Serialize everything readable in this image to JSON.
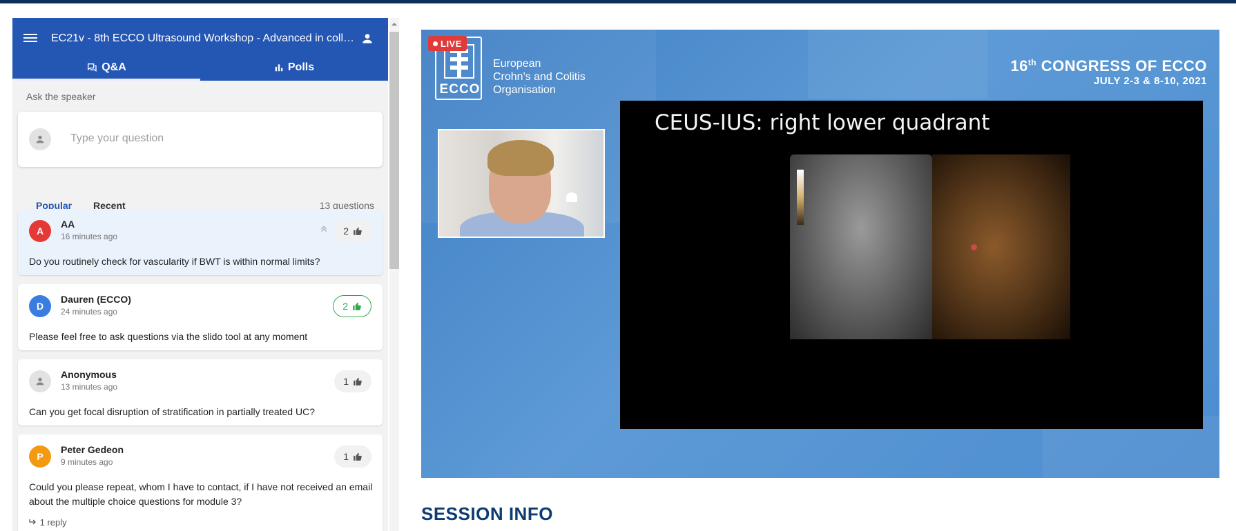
{
  "header": {
    "title": "EC21v - 8th ECCO Ultrasound Workshop - Advanced in colla..."
  },
  "tabs": [
    {
      "label": "Q&A"
    },
    {
      "label": "Polls"
    }
  ],
  "ask": {
    "label": "Ask the speaker",
    "placeholder": "Type your question"
  },
  "sort": {
    "popular": "Popular",
    "recent": "Recent",
    "count": "13 questions"
  },
  "questions": [
    {
      "initial": "A",
      "author": "AA",
      "time": "16 minutes ago",
      "likes": "2",
      "text": "Do you routinely check for vascularity if BWT is within normal limits?",
      "avatar_color": "#e53935"
    },
    {
      "initial": "D",
      "author": "Dauren (ECCO)",
      "time": "24 minutes ago",
      "likes": "2",
      "text": "Please feel free to ask questions via the slido tool at any moment",
      "avatar_color": "#3a7de0"
    },
    {
      "initial": "",
      "author": "Anonymous",
      "time": "13 minutes ago",
      "likes": "1",
      "text": "Can you get focal disruption of stratification in partially treated UC?",
      "avatar_color": "#e2e2e2"
    },
    {
      "initial": "P",
      "author": "Peter Gedeon",
      "time": "9 minutes ago",
      "likes": "1",
      "text": "Could you please repeat, whom I have to contact, if I have not received an email about the multiple choice questions for module 3?",
      "avatar_color": "#f39a12",
      "reply": "1 reply"
    }
  ],
  "video": {
    "live_badge": "LIVE",
    "logo_text": "ECCO",
    "org_line1": "European",
    "org_line2": "Crohn's and Colitis",
    "org_line3": "Organisation",
    "congress_num": "16",
    "congress_sup": "th",
    "congress_rest": " CONGRESS OF ECCO",
    "congress_dates": "JULY 2-3 & 8-10, 2021",
    "slide_title": "CEUS-IUS: right lower quadrant"
  },
  "session_info": "SESSION INFO",
  "colors": {
    "accent": "#2456b3",
    "liked": "#2ea84a",
    "session": "#0d3b73"
  }
}
